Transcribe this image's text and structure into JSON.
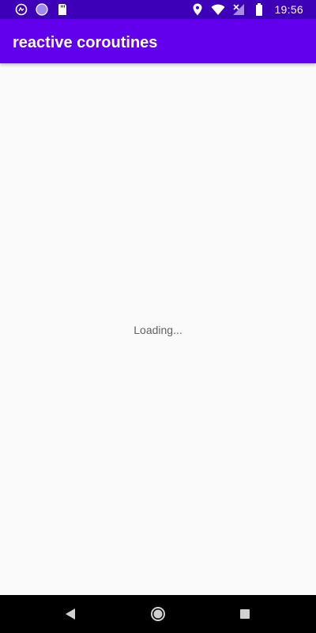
{
  "status_bar": {
    "time": "19:56",
    "left_icons": [
      "gallery-icon",
      "circle-app-icon",
      "sd-card-icon"
    ],
    "right_icons": [
      "location-icon",
      "wifi-icon",
      "cellular-no-signal-icon",
      "battery-icon"
    ],
    "background": "#3d00b8"
  },
  "app_bar": {
    "title": "reactive coroutines",
    "background": "#6200ee"
  },
  "content": {
    "loading_text": "Loading..."
  },
  "nav_bar": {
    "buttons": [
      "back-icon",
      "home-icon",
      "recents-icon"
    ]
  }
}
